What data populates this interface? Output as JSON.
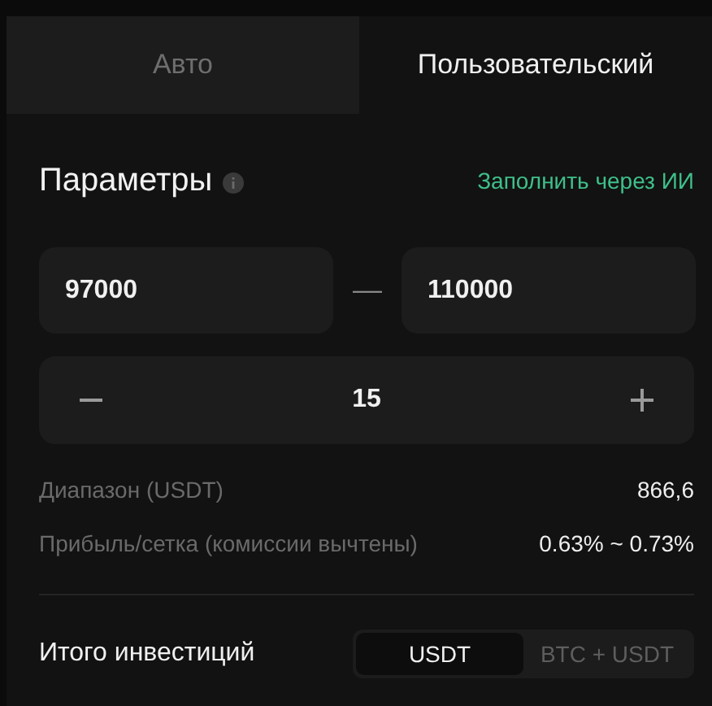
{
  "tabs": [
    {
      "label": "Авто",
      "selected": false
    },
    {
      "label": "Пользовательский",
      "selected": true
    }
  ],
  "parameters": {
    "title": "Параметры",
    "ai_link": "Заполнить через ИИ"
  },
  "range": {
    "low": "97000",
    "separator": "—",
    "high": "110000"
  },
  "grid_count": {
    "value": "15"
  },
  "info_rows": [
    {
      "label": "Диапазон (USDT)",
      "value": "866,6"
    },
    {
      "label": "Прибыль/сетка (комиссии вычтены)",
      "value": "0.63% ~ 0.73%"
    }
  ],
  "investment": {
    "label": "Итого инвестиций",
    "options": [
      {
        "label": "USDT",
        "selected": true
      },
      {
        "label": "BTC + USDT",
        "selected": false
      }
    ]
  }
}
